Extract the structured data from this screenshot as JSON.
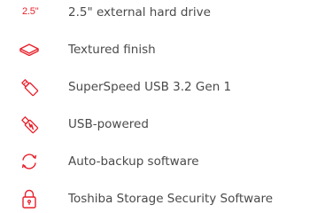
{
  "accent_color": "#e8202a",
  "text_color": "#4a4a4a",
  "features": [
    {
      "icon": "size-2-5-inch-icon",
      "icon_text": "2.5\"",
      "label": "2.5\" external hard drive"
    },
    {
      "icon": "textured-finish-icon",
      "label": "Textured finish"
    },
    {
      "icon": "usb-drive-icon",
      "label": "SuperSpeed USB 3.2 Gen 1"
    },
    {
      "icon": "usb-power-icon",
      "label": "USB-powered"
    },
    {
      "icon": "sync-arrows-icon",
      "label": "Auto-backup software"
    },
    {
      "icon": "padlock-icon",
      "label": "Toshiba Storage Security Software"
    }
  ]
}
